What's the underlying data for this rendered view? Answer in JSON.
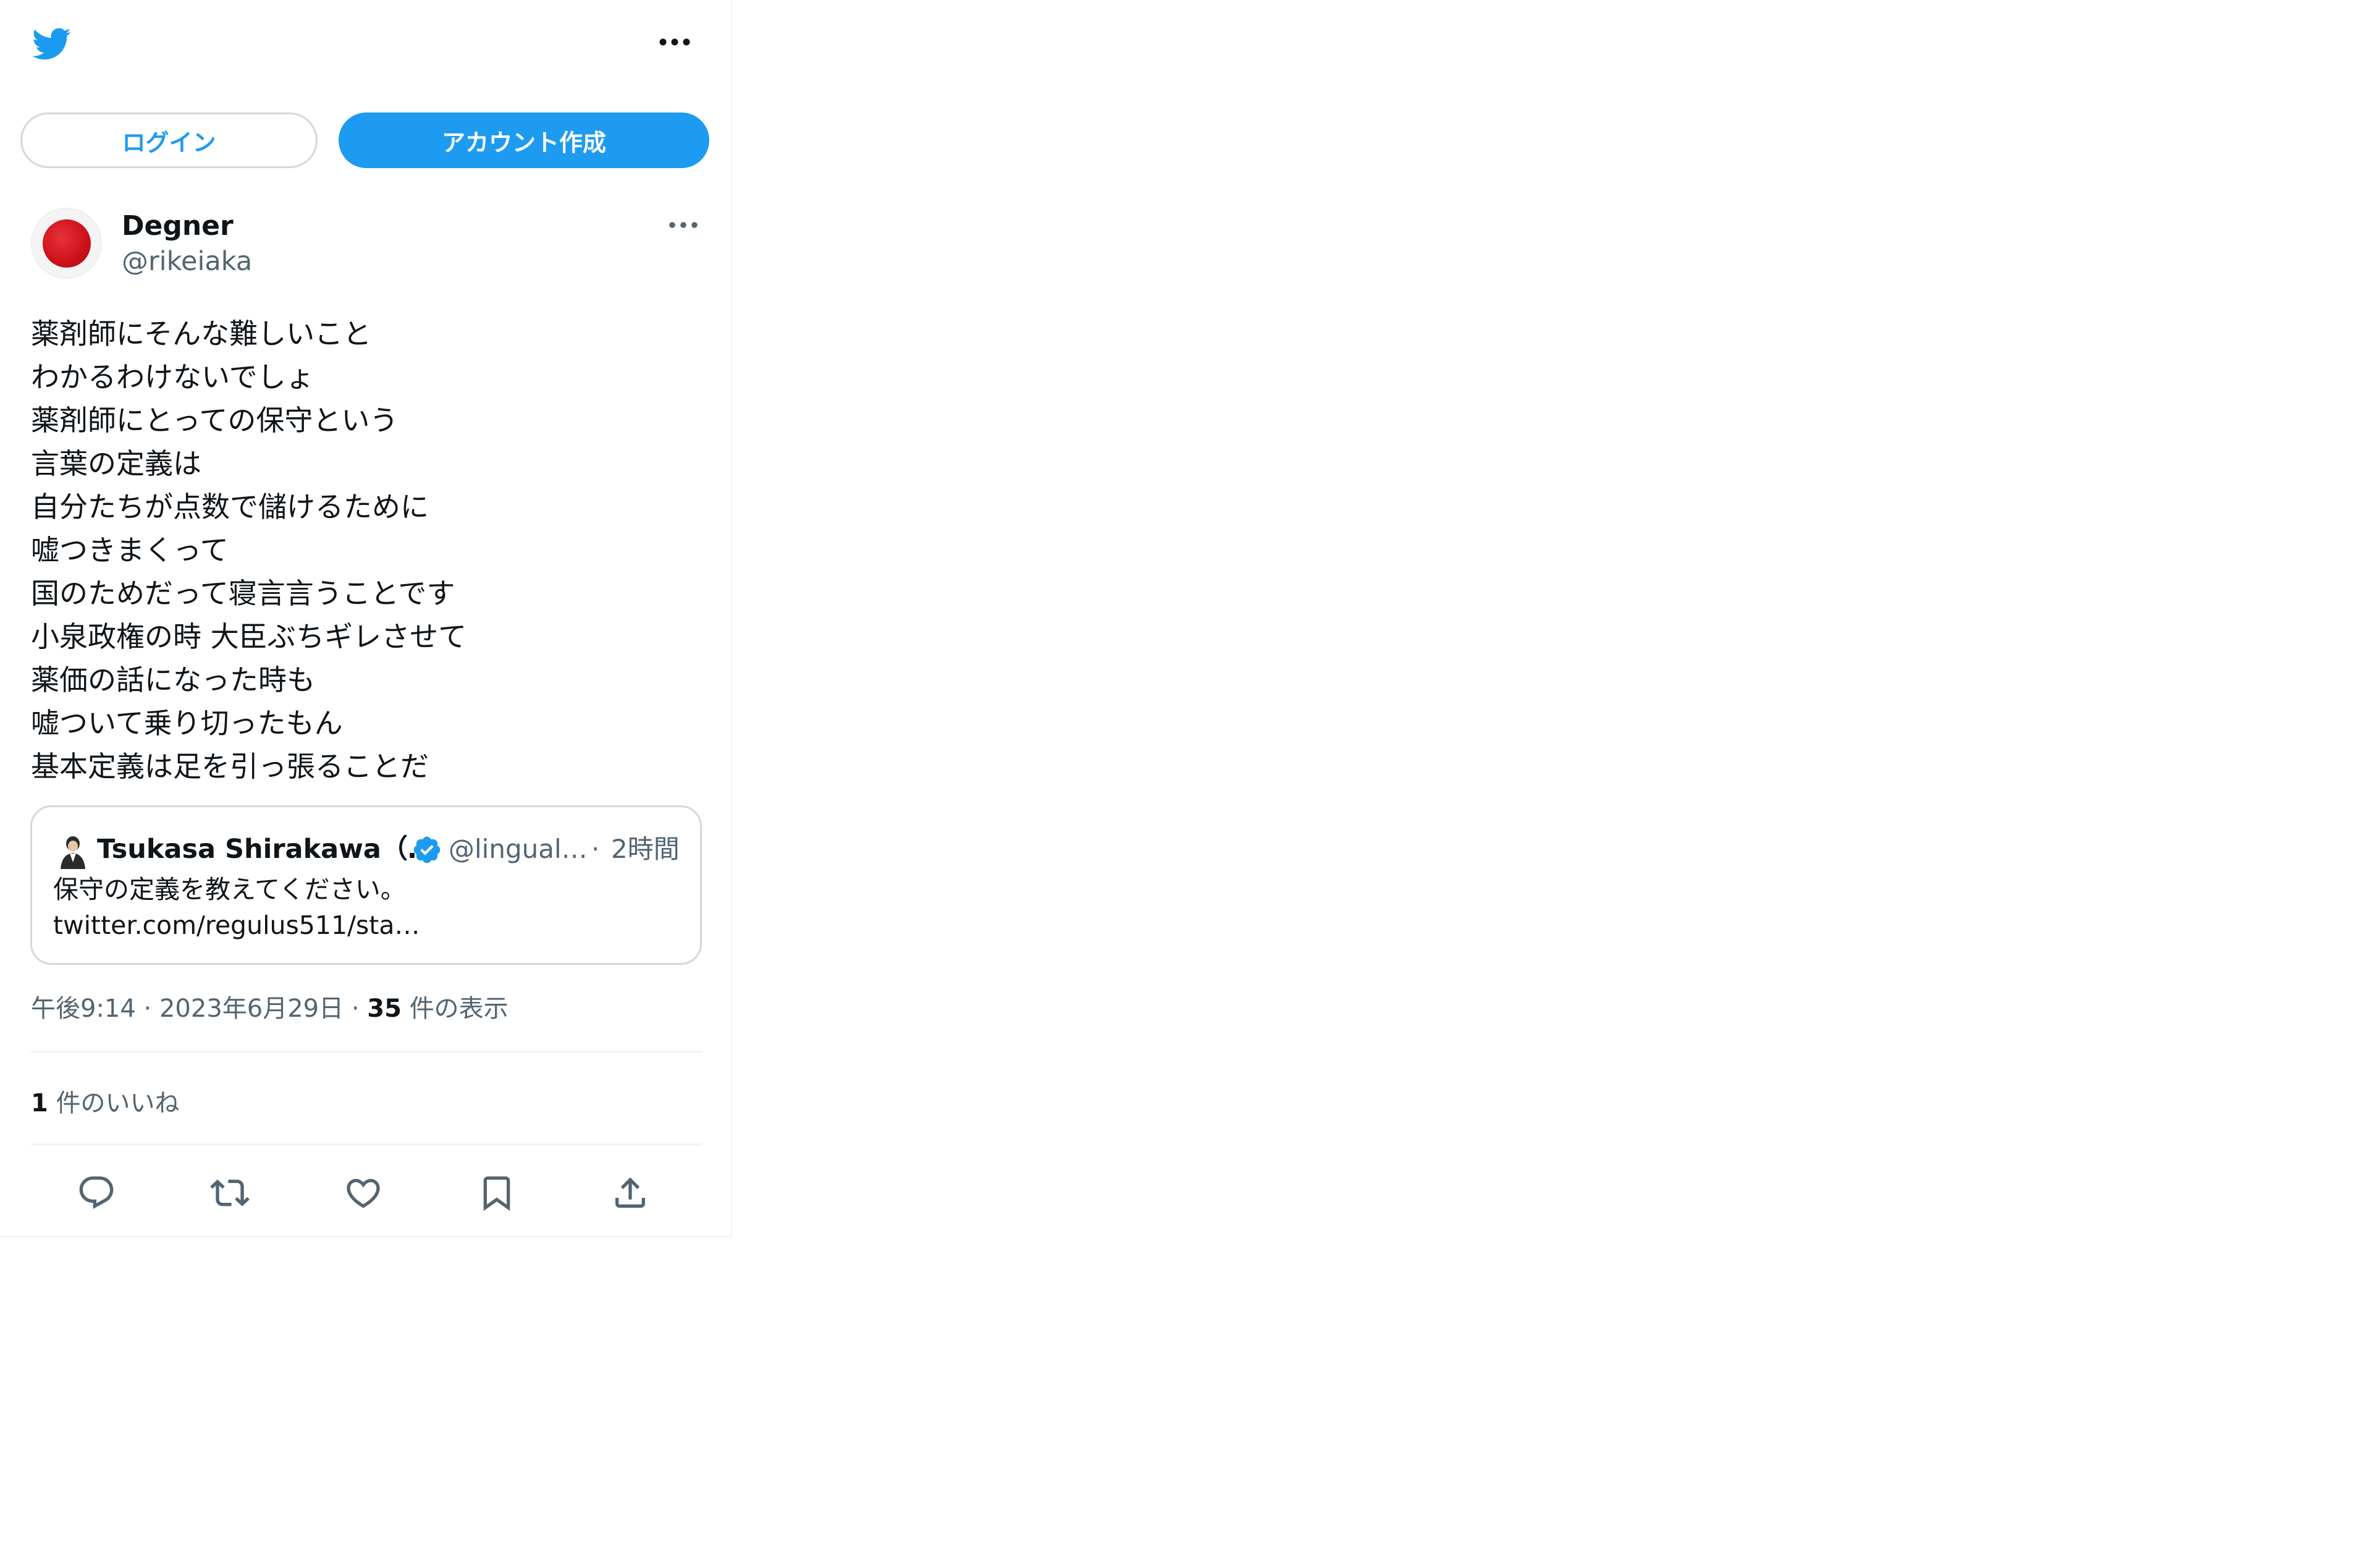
{
  "header": {
    "logo_icon": "twitter-bird-icon",
    "more_icon": "more-horizontal-icon",
    "login_label": "ログイン",
    "signup_label": "アカウント作成"
  },
  "tweet": {
    "author_name": "Degner",
    "author_handle": "@rikeiaka",
    "avatar_color": "#cc1019",
    "text": "薬剤師にそんな難しいこと\nわかるわけないでしょ\n薬剤師にとっての保守という\n言葉の定義は\n自分たちが点数で儲けるために\n嘘つきまくって\n国のためだって寝言言うことです\n小泉政権の時 大臣ぶちギレさせて\n薬価の話になった時も\n嘘ついて乗り切ったもん\n基本定義は足を引っ張ることだ",
    "quote": {
      "author_name": "Tsukasa Shirakawa（…",
      "author_handle": "@lingual…",
      "separator": "·",
      "time": "2時間",
      "text": "保守の定義を教えてください。",
      "link": "twitter.com/regulus511/sta…"
    },
    "time": "午後9:14",
    "date_sep": "·",
    "date": "2023年6月29日",
    "views_sep": "·",
    "views_count": "35",
    "views_label": "件の表示",
    "likes_count": "1",
    "likes_label": "件のいいね"
  },
  "actions": [
    "reply-icon",
    "retweet-icon",
    "like-icon",
    "bookmark-icon",
    "share-icon"
  ],
  "colors": {
    "accent": "#1d9bf0",
    "muted_text": "#536471",
    "border": "#cfd9de"
  }
}
